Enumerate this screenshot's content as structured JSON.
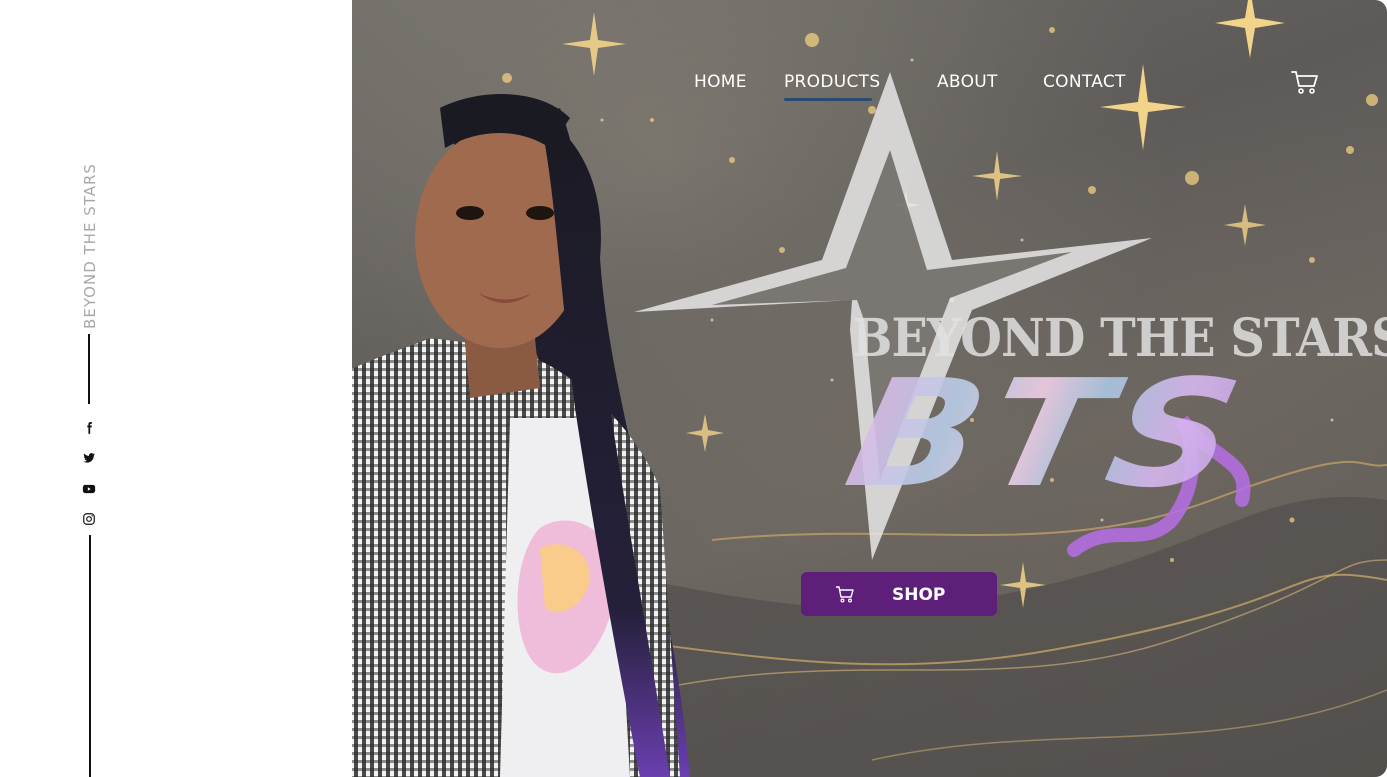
{
  "sidebar": {
    "brand_vertical": "BEYOND THE STARS",
    "social_icons": [
      "facebook-icon",
      "twitter-icon",
      "youtube-icon",
      "instagram-icon"
    ]
  },
  "nav": {
    "items": [
      {
        "label": "HOME"
      },
      {
        "label": "PRODUCTS",
        "active": true
      },
      {
        "label": "ABOUT"
      },
      {
        "label": "CONTACT"
      }
    ],
    "cart_icon": "cart-icon"
  },
  "hero": {
    "brand_title": "BEYOND THE STARS",
    "logo_text": "BTS",
    "shop_button": {
      "label": "SHOP",
      "icon": "cart-icon"
    }
  },
  "colors": {
    "accent_purple": "#5e1f7a",
    "nav_underline": "#2b4a70",
    "vertical_text": "#a8a8a8"
  }
}
